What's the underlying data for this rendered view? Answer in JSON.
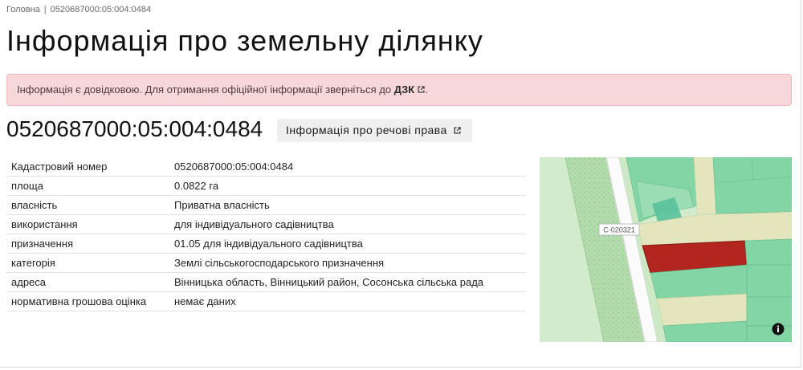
{
  "breadcrumb": {
    "home_label": "Головна",
    "separator": "|",
    "current_label": "0520687000:05:004:0484"
  },
  "page_title": "Інформація про земельну ділянку",
  "alert": {
    "text_before_link": "Інформація є довідковою. Для отримання офіційної інформації зверніться до ",
    "link_label": "ДЗК",
    "text_after_link": ".",
    "link_icon": "external-link-icon"
  },
  "parcel_header": {
    "cadastral_number": "0520687000:05:004:0484",
    "rights_button_label": "Інформація про речові права",
    "rights_button_icon": "external-link-icon"
  },
  "details": [
    {
      "label": "Кадастровий номер",
      "value": "0520687000:05:004:0484"
    },
    {
      "label": "площа",
      "value": "0.0822 га"
    },
    {
      "label": "власність",
      "value": "Приватна власність"
    },
    {
      "label": "використання",
      "value": "для індивідуального садівництва"
    },
    {
      "label": "призначення",
      "value": "01.05 для індивідуального садівництва"
    },
    {
      "label": "категорія",
      "value": "Землі сільськогосподарського призначення"
    },
    {
      "label": "адреса",
      "value": "Вінницька область, Вінницький район, Сосонська сільська рада"
    },
    {
      "label": "нормативна грошова оцінка",
      "value": "немає даних"
    }
  ],
  "map": {
    "road_label": "С-020321",
    "info_icon": "info-icon"
  },
  "colors": {
    "alert_background": "#f8d7da",
    "alert_border": "#f1b5bc",
    "alert_text": "#4e3a3c",
    "button_background": "#efefef",
    "parcel_highlight": "#b3251f",
    "parcel_fill": "#84d5a6",
    "text": "#1c1c1c"
  }
}
